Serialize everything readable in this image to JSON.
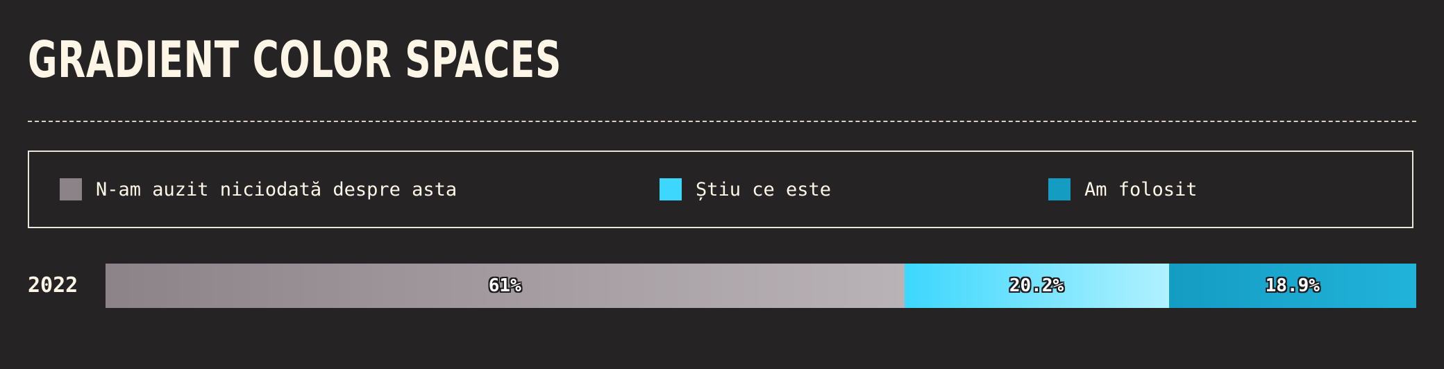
{
  "title": "GRADIENT COLOR SPACES",
  "legend": {
    "items": [
      {
        "label": "N-am auzit niciodată despre asta",
        "color": "#8c8389"
      },
      {
        "label": "Știu ce este",
        "color": "#3dd7fd"
      },
      {
        "label": "Am folosit",
        "color": "#159cc3"
      }
    ]
  },
  "chart_data": {
    "type": "bar",
    "orientation": "horizontal",
    "stacked": true,
    "normalized": true,
    "categories": [
      "2022"
    ],
    "series": [
      {
        "name": "N-am auzit niciodată despre asta",
        "values": [
          61
        ],
        "label": "61%",
        "color_start": "#8c8389",
        "color_end": "#b9b2b6"
      },
      {
        "name": "Știu ce este",
        "values": [
          20.2
        ],
        "label": "20.2%",
        "color_start": "#3dd7fd",
        "color_end": "#b0f1ff"
      },
      {
        "name": "Am folosit",
        "values": [
          18.9
        ],
        "label": "18.9%",
        "color_start": "#159cc3",
        "color_end": "#21b3da"
      }
    ],
    "xlim": [
      0,
      100.1
    ],
    "legend_position": "top"
  }
}
